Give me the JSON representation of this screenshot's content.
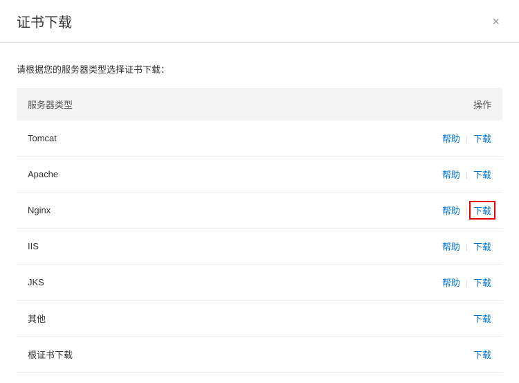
{
  "dialog": {
    "title": "证书下载",
    "closeLabel": "×"
  },
  "instruction": "请根据您的服务器类型选择证书下载：",
  "table": {
    "header": {
      "serverType": "服务器类型",
      "operation": "操作"
    },
    "rows": [
      {
        "name": "Tomcat",
        "help": "帮助",
        "download": "下载",
        "hasHelp": true,
        "highlighted": false
      },
      {
        "name": "Apache",
        "help": "帮助",
        "download": "下载",
        "hasHelp": true,
        "highlighted": false
      },
      {
        "name": "Nginx",
        "help": "帮助",
        "download": "下载",
        "hasHelp": true,
        "highlighted": true
      },
      {
        "name": "IIS",
        "help": "帮助",
        "download": "下载",
        "hasHelp": true,
        "highlighted": false
      },
      {
        "name": "JKS",
        "help": "帮助",
        "download": "下载",
        "hasHelp": true,
        "highlighted": false
      },
      {
        "name": "其他",
        "help": "",
        "download": "下载",
        "hasHelp": false,
        "highlighted": false
      },
      {
        "name": "根证书下载",
        "help": "",
        "download": "下载",
        "hasHelp": false,
        "highlighted": false
      }
    ],
    "divider": "|"
  }
}
